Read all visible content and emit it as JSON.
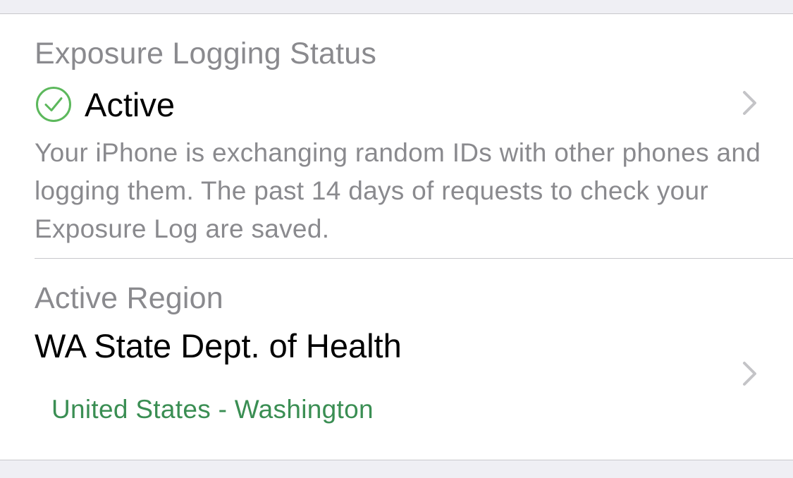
{
  "exposure_status": {
    "label": "Exposure Logging Status",
    "value": "Active",
    "status_icon": "checkmark-circle-icon",
    "status_color": "#5cb85c",
    "description": "Your iPhone is exchanging random IDs with other phones and logging them. The past 14 days of requests to check your Exposure Log are saved.",
    "chevron_icon": "chevron-right-icon"
  },
  "active_region": {
    "label": "Active Region",
    "value": "WA State Dept. of Health",
    "subtitle": "United States - Washington",
    "subtitle_color": "#3a8e53",
    "chevron_icon": "chevron-right-icon"
  },
  "colors": {
    "background": "#efeff4",
    "cell": "#ffffff",
    "secondary_text": "#8a8a8e",
    "separator": "#c8c8cc",
    "chevron": "#c4c4c7"
  }
}
